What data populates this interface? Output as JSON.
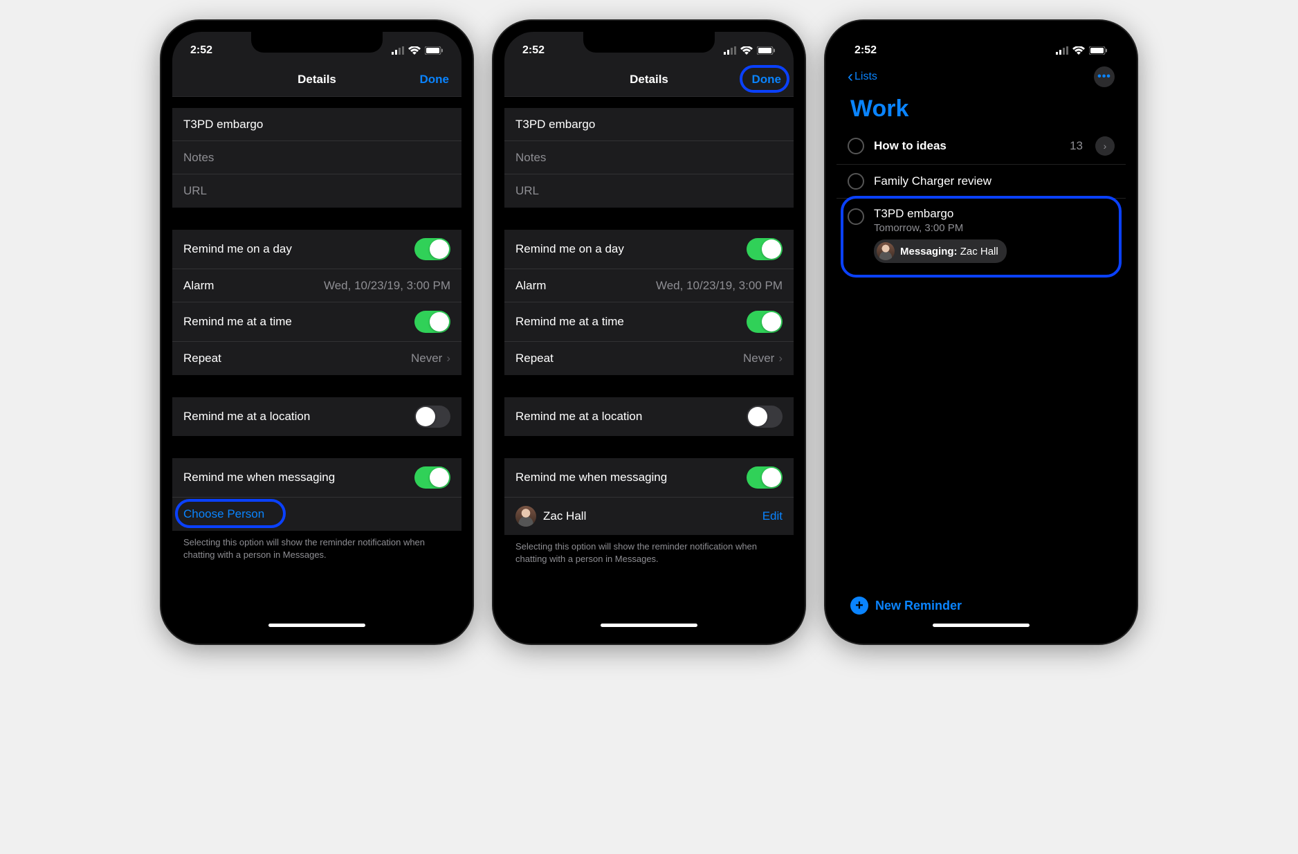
{
  "status": {
    "time": "2:52"
  },
  "details": {
    "title": "Details",
    "done": "Done",
    "reminder_title": "T3PD embargo",
    "notes_placeholder": "Notes",
    "url_placeholder": "URL",
    "remind_day_label": "Remind me on a day",
    "alarm_label": "Alarm",
    "alarm_value": "Wed, 10/23/19, 3:00 PM",
    "remind_time_label": "Remind me at a time",
    "repeat_label": "Repeat",
    "repeat_value": "Never",
    "remind_location_label": "Remind me at a location",
    "remind_messaging_label": "Remind me when messaging",
    "choose_person": "Choose Person",
    "person_name": "Zac Hall",
    "edit": "Edit",
    "footer": "Selecting this option will show the reminder notification when chatting with a person in Messages."
  },
  "list": {
    "back": "Lists",
    "title": "Work",
    "items": [
      {
        "title": "How to ideas",
        "bold": true,
        "count": "13",
        "disclosure": true
      },
      {
        "title": "Family Charger review"
      },
      {
        "title": "T3PD embargo",
        "subtitle": "Tomorrow, 3:00 PM",
        "messaging_label": "Messaging:",
        "messaging_person": "Zac Hall"
      }
    ],
    "new_reminder": "New Reminder"
  }
}
